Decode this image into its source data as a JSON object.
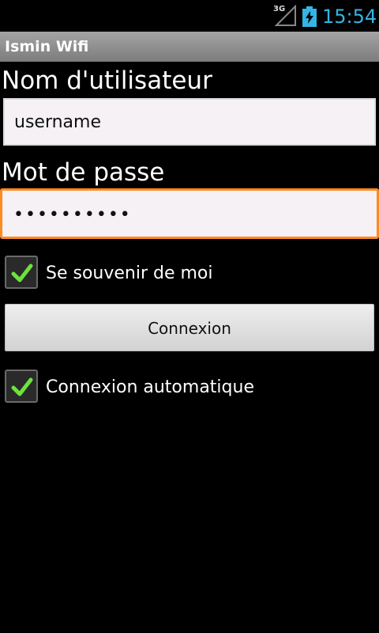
{
  "status_bar": {
    "network_type": "3G",
    "time": "15:54",
    "accent_color": "#33b5e5",
    "battery_charging": true,
    "icons": [
      "signal-icon",
      "battery-charging-icon"
    ]
  },
  "app": {
    "title": "Ismin Wifi"
  },
  "form": {
    "username_label": "Nom d'utilisateur",
    "username_value": "username",
    "password_label": "Mot de passe",
    "password_masked": "••••••••••",
    "focus_color": "#ff8a1f",
    "remember_me": {
      "label": "Se souvenir de moi",
      "checked": true
    },
    "connect_button_label": "Connexion",
    "auto_connect": {
      "label": "Connexion automatique",
      "checked": true
    }
  }
}
